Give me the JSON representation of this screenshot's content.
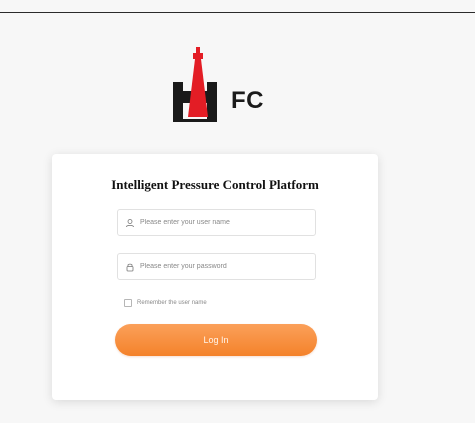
{
  "branding": {
    "logo_text": "FC"
  },
  "login": {
    "title": "Intelligent Pressure Control Platform",
    "username": {
      "placeholder": "Please enter your user name",
      "value": "",
      "icon": "user-icon"
    },
    "password": {
      "placeholder": "Please enter your password",
      "value": "",
      "icon": "lock-icon"
    },
    "remember_label": "Remember the user name",
    "remember_checked": false,
    "login_button": "Log In"
  },
  "colors": {
    "accent_orange": "#f4822a",
    "logo_red": "#e31d25",
    "logo_black": "#1a1a1a"
  }
}
